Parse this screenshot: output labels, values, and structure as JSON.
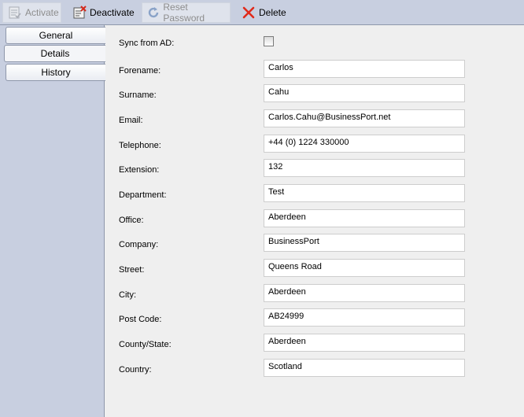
{
  "toolbar": {
    "activate": {
      "label": "Activate",
      "icon": "activate-doc-icon"
    },
    "deactivate": {
      "label": "Deactivate",
      "icon": "deactivate-doc-icon"
    },
    "reset_password": {
      "label": "Reset Password",
      "icon": "refresh-icon"
    },
    "delete": {
      "label": "Delete",
      "icon": "red-x-icon"
    }
  },
  "tabs": [
    {
      "label": "General"
    },
    {
      "label": "Details",
      "active": true
    },
    {
      "label": "History"
    }
  ],
  "form": {
    "sync_from_ad": {
      "label": "Sync from AD:",
      "checked": false
    },
    "fields": [
      {
        "label": "Forename:",
        "value": "Carlos"
      },
      {
        "label": "Surname:",
        "value": "Cahu"
      },
      {
        "label": "Email:",
        "value": "Carlos.Cahu@BusinessPort.net"
      },
      {
        "label": "Telephone:",
        "value": "+44 (0) 1224 330000"
      },
      {
        "label": "Extension:",
        "value": "132"
      },
      {
        "label": "Department:",
        "value": "Test"
      },
      {
        "label": "Office:",
        "value": "Aberdeen"
      },
      {
        "label": "Company:",
        "value": "BusinessPort"
      },
      {
        "label": "Street:",
        "value": "Queens Road"
      },
      {
        "label": "City:",
        "value": "Aberdeen"
      },
      {
        "label": "Post Code:",
        "value": "AB24999"
      },
      {
        "label": "County/State:",
        "value": "Aberdeen"
      },
      {
        "label": "Country:",
        "value": "Scotland"
      }
    ]
  },
  "colors": {
    "toolbar_bg": "#c8cfe0",
    "sidebar_bg": "#c8cfe0",
    "content_bg": "#efefef",
    "delete_icon": "#e02a1a",
    "refresh_icon": "#8aa3c8"
  }
}
